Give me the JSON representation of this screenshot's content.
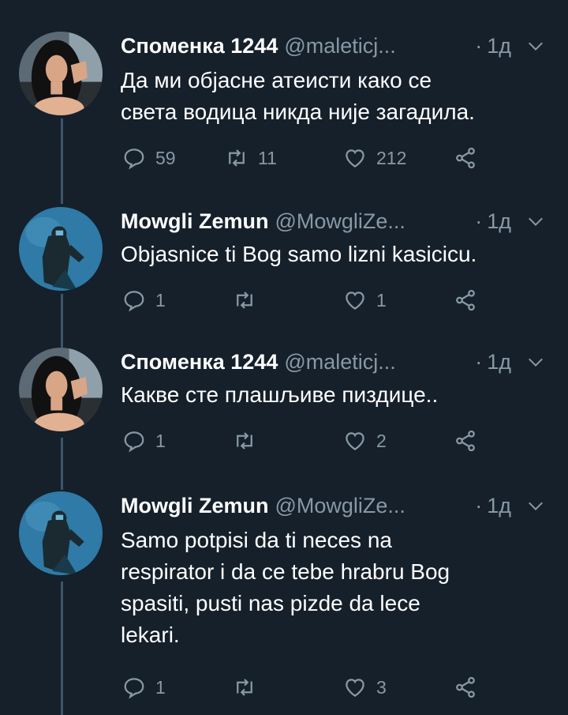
{
  "colors": {
    "background": "#15202b",
    "secondary_text": "#8899a6",
    "thread_line": "#3d5466"
  },
  "tweets": [
    {
      "name": "Споменка 1244",
      "handle": "@maleticj...",
      "dot": "·",
      "time": "1д",
      "text_lines": [
        "Да ми објасне атеисти како се",
        "света водица никда није загадила."
      ],
      "replies": "59",
      "retweets": "11",
      "likes": "212",
      "avatar_icon": "woman-avatar"
    },
    {
      "name": "Mowgli Zemun",
      "handle": "@MowgliZe...",
      "dot": "·",
      "time": "1д",
      "text_lines": [
        "Objasnice ti Bog samo lizni kasicicu."
      ],
      "replies": "1",
      "retweets": "",
      "likes": "1",
      "avatar_icon": "diver-avatar"
    },
    {
      "name": "Споменка 1244",
      "handle": "@maleticj...",
      "dot": "·",
      "time": "1д",
      "text_lines": [
        "Какве сте плашљиве пиздице.."
      ],
      "replies": "1",
      "retweets": "",
      "likes": "2",
      "avatar_icon": "woman-avatar"
    },
    {
      "name": "Mowgli Zemun",
      "handle": "@MowgliZe...",
      "dot": "·",
      "time": "1д",
      "text_lines": [
        "Samo potpisi da ti neces na",
        "respirator i da ce tebe hrabru Bog",
        "spasiti, pusti nas pizde da lece",
        "lekari."
      ],
      "replies": "1",
      "retweets": "",
      "likes": "3",
      "avatar_icon": "diver-avatar"
    }
  ]
}
